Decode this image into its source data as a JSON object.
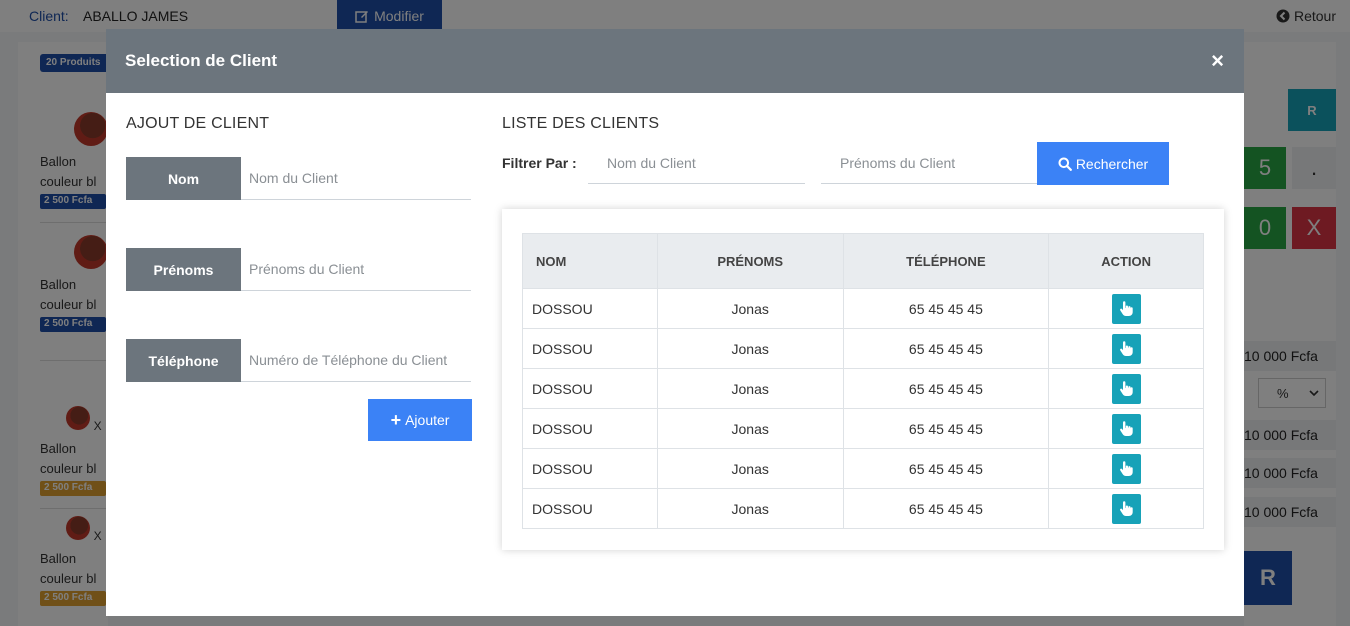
{
  "background": {
    "client_label": "Client:",
    "client_name": "ABALLO JAMES",
    "modify_label": "Modifier",
    "back_label": "Retour",
    "badge": "20 Produits",
    "products": [
      {
        "name_line1": "Ballon",
        "name_line2": "couleur bl",
        "price": "2 500 Fcfa",
        "price_color": "#1f4fa8"
      },
      {
        "name_line1": "Ballon",
        "name_line2": "couleur bl",
        "price": "2 500 Fcfa",
        "price_color": "#1f4fa8"
      },
      {
        "name_line1": "Ballon",
        "name_line2": "couleur bl",
        "price": "2 500 Fcfa",
        "price_color": "#e0a030"
      },
      {
        "name_line1": "Ballon",
        "name_line2": "couleur bl",
        "price": "2 500 Fcfa",
        "price_color": "#e0a030"
      }
    ],
    "product_small_label": "X",
    "keypad": {
      "r": "R",
      "five": "5",
      "dot": ".",
      "zero": "0",
      "x": "X"
    },
    "amounts": [
      "10 000 Fcfa",
      "10 000 Fcfa",
      "10 000 Fcfa",
      "10 000 Fcfa"
    ],
    "percent_select": "%",
    "bottom_button": "R"
  },
  "modal": {
    "title": "Selection de Client",
    "close": "×",
    "add_section": {
      "title": "AJOUT DE CLIENT",
      "fields": [
        {
          "label": "Nom",
          "placeholder": "Nom du Client",
          "value": ""
        },
        {
          "label": "Prénoms",
          "placeholder": "Prénoms du Client",
          "value": ""
        },
        {
          "label": "Téléphone",
          "placeholder": "Numéro de Téléphone du Client",
          "value": ""
        }
      ],
      "submit_label": "Ajouter"
    },
    "list_section": {
      "title": "LISTE DES CLIENTS",
      "filter_label": "Filtrer Par :",
      "filter_name_placeholder": "Nom du Client",
      "filter_firstname_placeholder": "Prénoms du Client",
      "search_label": "Rechercher",
      "columns": [
        "NOM",
        "PRÉNOMS",
        "TÉLÉPHONE",
        "ACTION"
      ],
      "rows": [
        {
          "nom": "DOSSOU",
          "prenoms": "Jonas",
          "telephone": "65 45 45 45"
        },
        {
          "nom": "DOSSOU",
          "prenoms": "Jonas",
          "telephone": "65 45 45 45"
        },
        {
          "nom": "DOSSOU",
          "prenoms": "Jonas",
          "telephone": "65 45 45 45"
        },
        {
          "nom": "DOSSOU",
          "prenoms": "Jonas",
          "telephone": "65 45 45 45"
        },
        {
          "nom": "DOSSOU",
          "prenoms": "Jonas",
          "telephone": "65 45 45 45"
        },
        {
          "nom": "DOSSOU",
          "prenoms": "Jonas",
          "telephone": "65 45 45 45"
        }
      ],
      "action_icon": "hand-pointer-icon",
      "action_color": "#17a2b8"
    }
  },
  "colors": {
    "header_gray": "#6c757d",
    "primary_blue": "#3b82f6",
    "teal": "#17a2b8"
  }
}
